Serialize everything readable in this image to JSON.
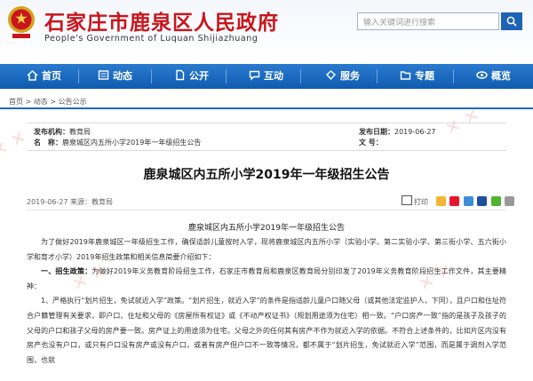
{
  "site": {
    "title": "石家庄市鹿泉区人民政府",
    "subtitle": "People's Government of Luquan Shijiazhuang",
    "search_placeholder": "输入关键词进行搜索"
  },
  "nav": {
    "items": [
      {
        "label": "首页",
        "icon": "home-icon"
      },
      {
        "label": "动态",
        "icon": "news-icon"
      },
      {
        "label": "公开",
        "icon": "document-icon"
      },
      {
        "label": "互动",
        "icon": "chat-icon"
      },
      {
        "label": "服务",
        "icon": "service-icon"
      },
      {
        "label": "专题",
        "icon": "folder-icon"
      },
      {
        "label": "概览",
        "icon": "eye-icon"
      }
    ]
  },
  "breadcrumb": "首页 > 动态 > 公告公示",
  "meta": {
    "org_label": "发布机构：",
    "org_value": "教育局",
    "date_label": "发布日期：",
    "date_value": "2019-06-27",
    "name_label": "名　称：",
    "name_value": "鹿泉城区内五所小学2019年一年级招生公告",
    "docno_label": "文 号："
  },
  "article": {
    "title": "鹿泉城区内五所小学2019年一年级招生公告",
    "info": "2019-06-27    来源：教育局",
    "print_label": "打印",
    "sub_title": "鹿泉城区内五所小学2019年一年级招生公告",
    "p1": "为了做好2019年鹿泉城区一年级招生工作，确保适龄儿童按时入学，现将鹿泉城区内五所小学（实验小学、第二实验小学、第三街小学、五六街小学和育才小学）2019年招生政策和相关信息简要介绍如下：",
    "p2_head": "一、招生政策：",
    "p2": "为做好2019年义务教育阶段招生工作，石家庄市教育局和鹿泉区教育局分别印发了2019年义务教育阶段招生工作文件，其主要精神：",
    "p3": "1、严格执行“划片招生，免试就近入学”政策。“划片招生，就近入学”的条件是指适龄儿童户口随父母（或其他法定监护人，下同），且户口和住址符合户籍管理有关要求，即户口、住址和父母的《房屋所有权证》或《不动产权证书》（规划用途须为住宅）相一致。“户口房产一致”指的是孩子及孩子的父母的户口和孩子父母的房产要一致。房产证上的用途须为住宅。父母之外的任何其有房产不作为就近入学的依据。不符合上述条件的，比如片区内没有房产也没有户口，或只有户口没有房产或没有户口，或者有房产但户口不一致等情况，都不属于“划片招生，免试就近入学”范围，而是属于调剂入学范围，也就"
  }
}
